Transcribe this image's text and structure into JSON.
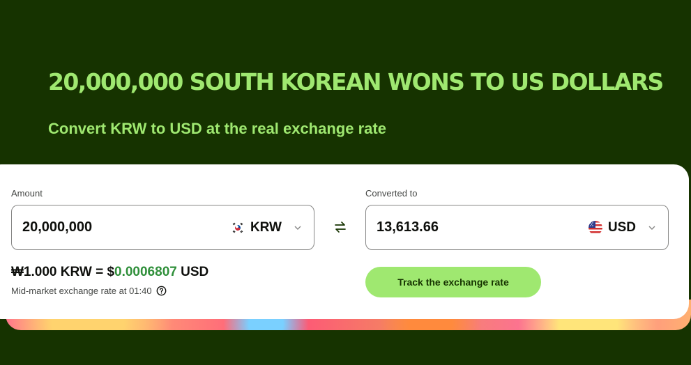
{
  "header": {
    "title": "20,000,000 SOUTH KOREAN WONS TO US DOLLARS",
    "subtitle": "Convert KRW to USD at the real exchange rate"
  },
  "converter": {
    "amount_label": "Amount",
    "amount_value": "20,000,000",
    "from_currency": {
      "code": "KRW",
      "flag_icon": "south-korea-flag-icon"
    },
    "converted_label": "Converted to",
    "converted_value": "13,613.66",
    "to_currency": {
      "code": "USD",
      "flag_icon": "us-flag-icon"
    },
    "rate_prefix": "₩1.000 KRW = $",
    "rate_value": "0.0006807",
    "rate_suffix": " USD",
    "rate_note": "Mid-market exchange rate at 01:40",
    "track_button_label": "Track the exchange rate"
  },
  "colors": {
    "background": "#163300",
    "accent": "#9fe870",
    "rate_highlight": "#2f8f3a"
  }
}
